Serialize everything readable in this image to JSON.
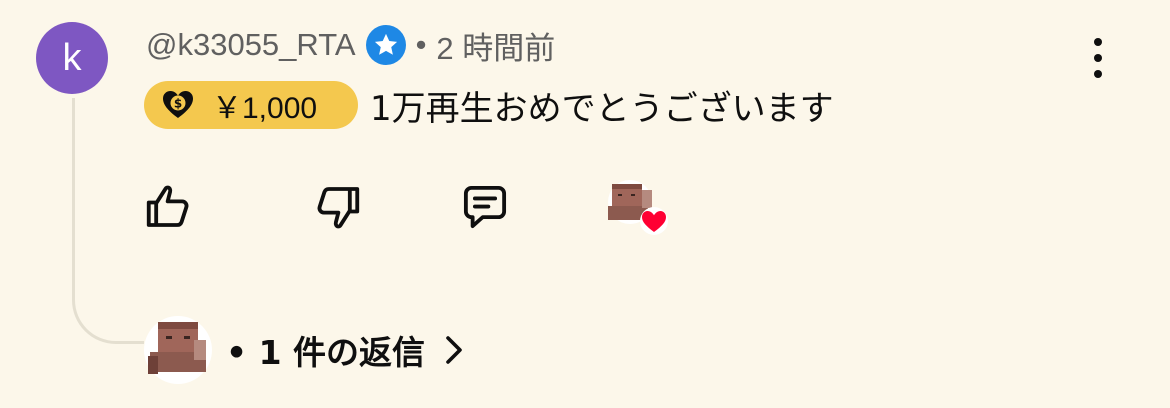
{
  "comment": {
    "avatar_letter": "k",
    "author": "@k33055_RTA",
    "verified_icon": "verified-star-icon",
    "separator": "•",
    "timestamp": "2 時間前",
    "superthanks": {
      "icon": "heart-coin-icon",
      "amount": "￥1,000",
      "color": "#f4c84e"
    },
    "text": "1万再生おめでとうございます",
    "actions": {
      "like_icon": "thumb-up-icon",
      "dislike_icon": "thumb-down-icon",
      "reply_icon": "reply-comment-icon",
      "creator_heart_icon": "creator-heart-icon"
    },
    "menu_icon": "more-vert-icon",
    "replies": {
      "label": "• 1 件の返信",
      "chevron": "chevron-right-icon"
    }
  },
  "colors": {
    "background": "#fcf7ea",
    "avatar": "#7e57c2",
    "verified": "#1e88e5",
    "heart": "#ff0033"
  }
}
